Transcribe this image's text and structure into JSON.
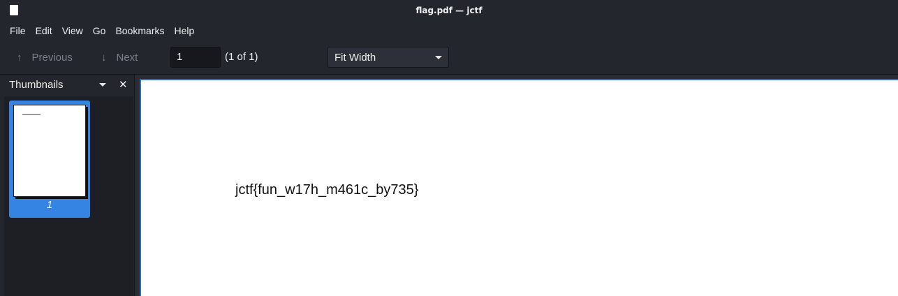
{
  "window": {
    "title": "flag.pdf — jctf",
    "app_icon": "document-icon"
  },
  "menu": {
    "items": [
      "File",
      "Edit",
      "View",
      "Go",
      "Bookmarks",
      "Help"
    ]
  },
  "toolbar": {
    "previous_label": "Previous",
    "previous_icon": "arrow-up-icon",
    "next_label": "Next",
    "next_icon": "arrow-down-icon",
    "page_value": "1",
    "page_count": "(1 of 1)",
    "zoom_selected": "Fit Width"
  },
  "sidebar": {
    "title": "Thumbnails",
    "thumbnails": [
      {
        "page_number": "1",
        "selected": true
      }
    ]
  },
  "document": {
    "content": "jctf{fun_w17h_m461c_by735}"
  },
  "colors": {
    "accent": "#3584e4",
    "background": "#24262e",
    "page": "#ffffff"
  }
}
